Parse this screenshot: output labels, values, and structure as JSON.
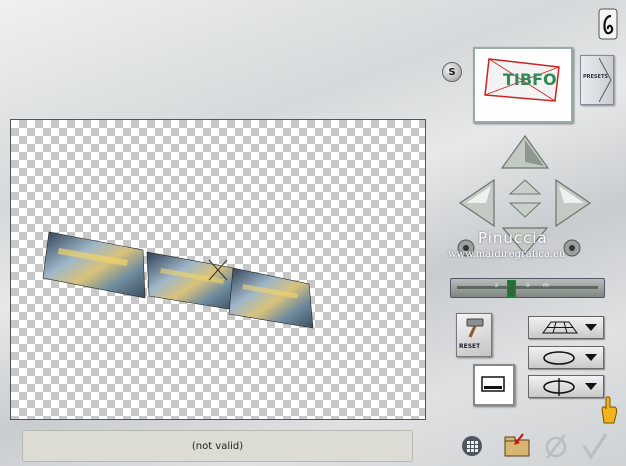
{
  "status": {
    "text": "(not valid)"
  },
  "watermark": {
    "name": "Pinuccia",
    "url": "www.maidiregrafica.eu"
  },
  "buttons": {
    "s_label": "S",
    "presets_label": "PRESETS",
    "reset_label": "RESET"
  },
  "slider": {
    "marks": [
      "z",
      "o",
      "m"
    ],
    "level": 0.38
  },
  "thumbnail": {
    "text": "TIBFO"
  },
  "icons": [
    "logo-icon",
    "arrow-up-icon",
    "arrow-down-icon",
    "arrow-left-icon",
    "arrow-right-icon",
    "rotate-left-icon",
    "rotate-right-icon",
    "hammer-icon",
    "perspective-grid-icon",
    "rotate-loop-icon",
    "flip-loop-icon",
    "grid-icon",
    "folder-icon",
    "null-icon",
    "checkmark-icon",
    "hand-icon"
  ],
  "colors": {
    "accent": "#2c6b34",
    "canvas_checker": "#c8c8c8"
  }
}
